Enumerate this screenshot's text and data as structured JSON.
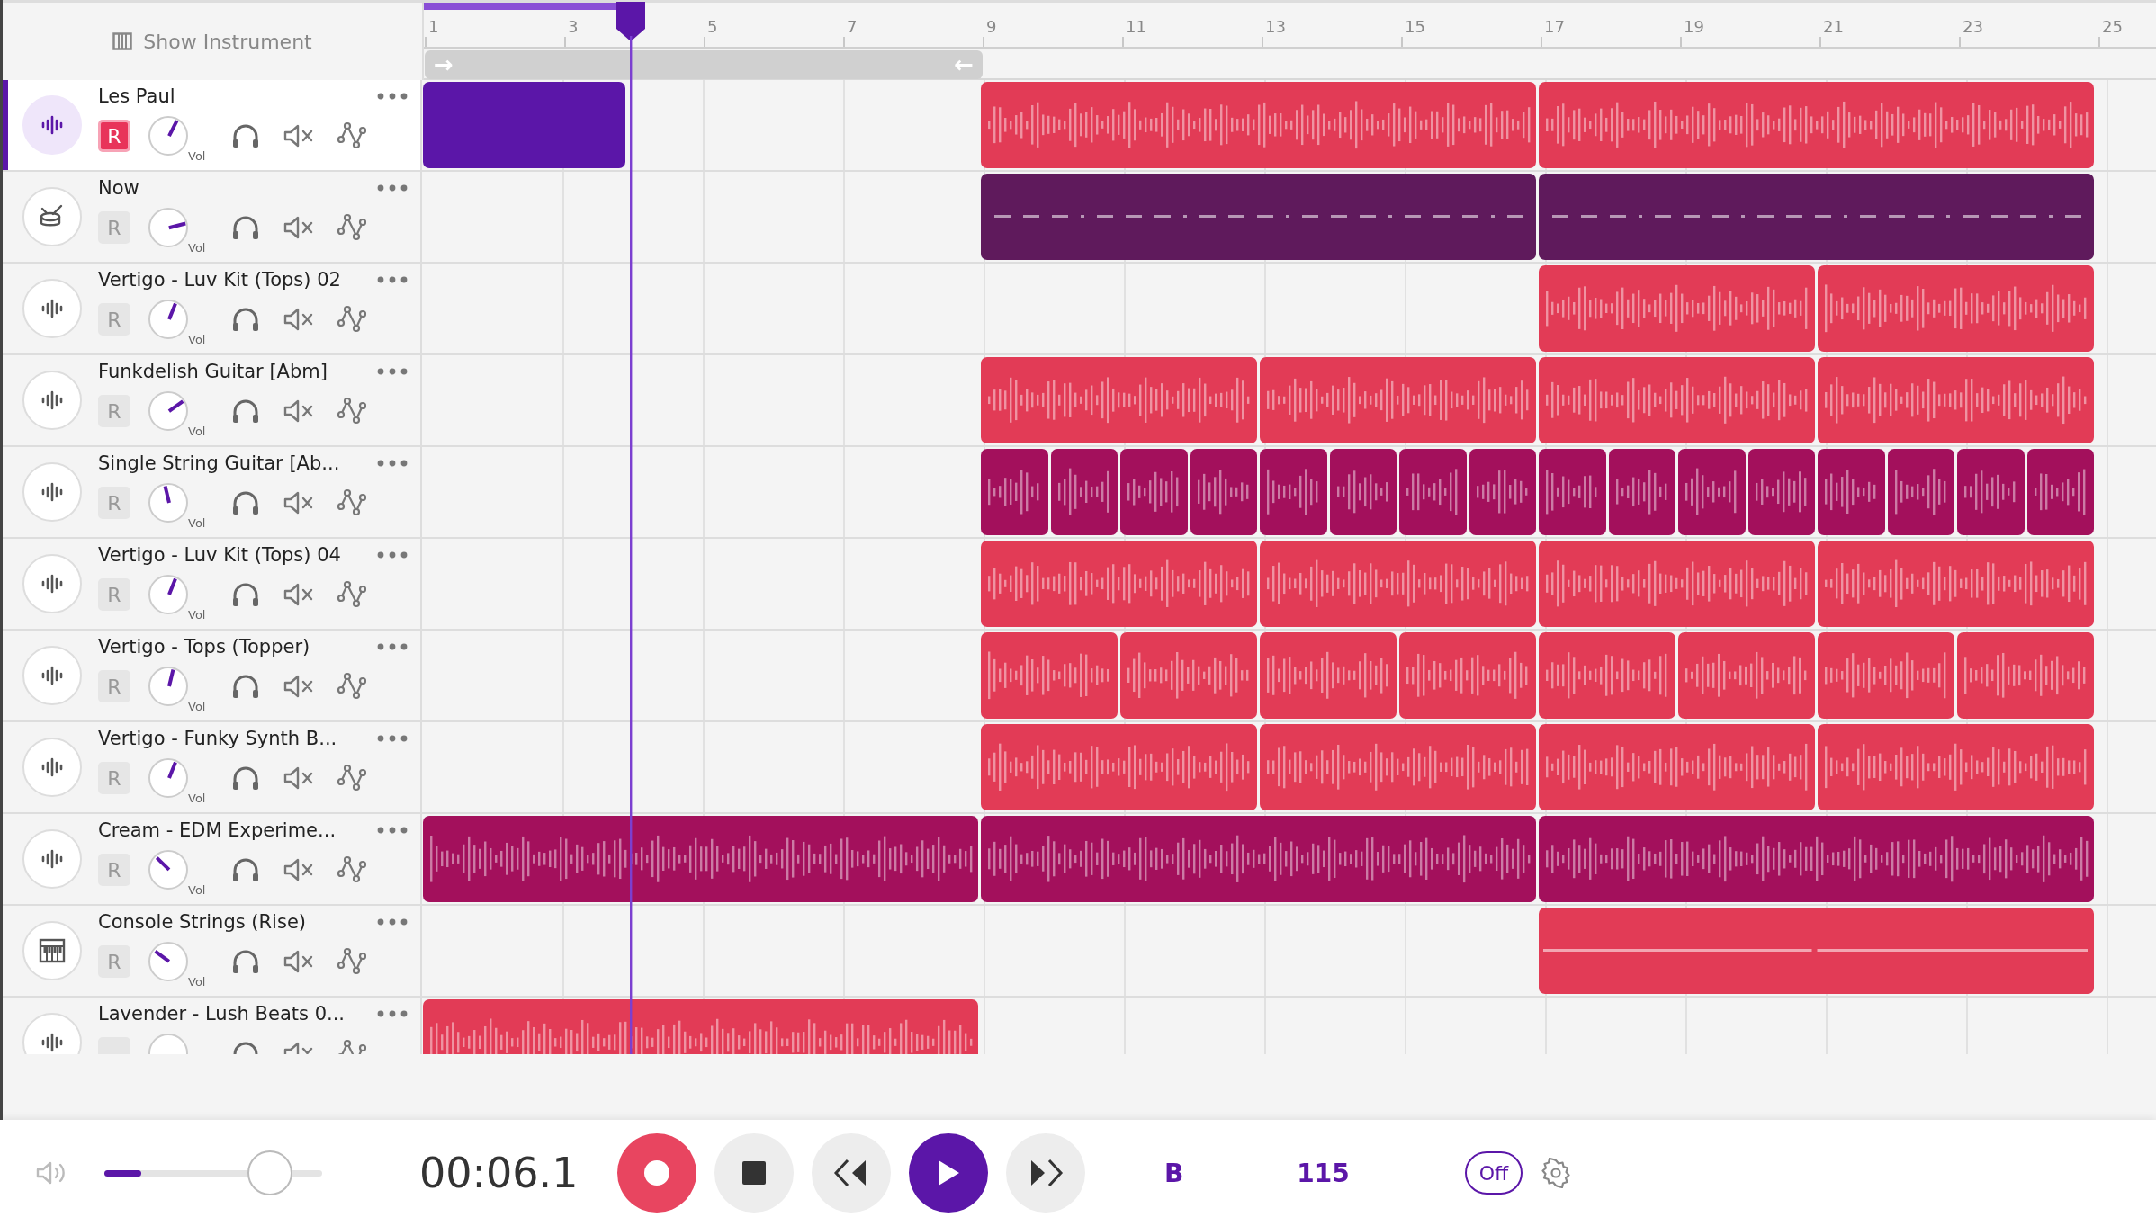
{
  "header": {
    "show_instrument": "Show Instrument"
  },
  "ruler": {
    "labels": [
      "1",
      "3",
      "5",
      "7",
      "9",
      "11",
      "13",
      "15",
      "17",
      "19",
      "21",
      "23",
      "25"
    ],
    "cycle": {
      "start_arrow": "→",
      "end_arrow": "←"
    }
  },
  "playhead": {
    "level": 0.119
  },
  "tracks": [
    {
      "name": "Les Paul",
      "kind": "audio",
      "selected": true,
      "armed": true,
      "level": 0.6,
      "record_label": "R",
      "knob_label": "Vol",
      "clips": [
        {
          "kind": "recording",
          "color": "#5b16a8"
        },
        {
          "kind": "audio",
          "color": "#e23b56"
        },
        {
          "kind": "audio",
          "color": "#e23b56"
        }
      ]
    },
    {
      "name": "Now",
      "kind": "drums",
      "selected": false,
      "armed": false,
      "level": 0.78,
      "record_label": "R",
      "knob_label": "Vol",
      "clips": [
        {
          "kind": "pattern",
          "color": "#5f1a5c"
        },
        {
          "kind": "pattern",
          "color": "#5f1a5c"
        }
      ]
    },
    {
      "name": "Vertigo - Luv Kit (Tops) 02",
      "kind": "audio",
      "selected": false,
      "armed": false,
      "level": 0.58,
      "record_label": "R",
      "knob_label": "Vol",
      "clips": [
        {
          "kind": "audio",
          "color": "#e23b56"
        },
        {
          "kind": "audio",
          "color": "#e23b56"
        }
      ]
    },
    {
      "name": "Funkdelish Guitar [Abm]",
      "kind": "audio",
      "selected": false,
      "armed": false,
      "level": 0.7,
      "record_label": "R",
      "knob_label": "Vol",
      "clips": [
        {
          "kind": "audio",
          "color": "#e23b56"
        },
        {
          "kind": "audio",
          "color": "#e23b56"
        },
        {
          "kind": "audio",
          "color": "#e23b56"
        },
        {
          "kind": "audio",
          "color": "#e23b56"
        }
      ]
    },
    {
      "name": "Single String Guitar [Ab...",
      "kind": "audio",
      "selected": false,
      "armed": false,
      "level": 0.45,
      "record_label": "R",
      "knob_label": "Vol",
      "clips": [
        {
          "kind": "audio",
          "color": "#a3105c"
        },
        {
          "kind": "audio",
          "color": "#a3105c"
        },
        {
          "kind": "audio",
          "color": "#a3105c"
        },
        {
          "kind": "audio",
          "color": "#a3105c"
        },
        {
          "kind": "audio",
          "color": "#a3105c"
        },
        {
          "kind": "audio",
          "color": "#a3105c"
        },
        {
          "kind": "audio",
          "color": "#a3105c"
        },
        {
          "kind": "audio",
          "color": "#a3105c"
        },
        {
          "kind": "audio",
          "color": "#a3105c"
        },
        {
          "kind": "audio",
          "color": "#a3105c"
        },
        {
          "kind": "audio",
          "color": "#a3105c"
        },
        {
          "kind": "audio",
          "color": "#a3105c"
        },
        {
          "kind": "audio",
          "color": "#a3105c"
        },
        {
          "kind": "audio",
          "color": "#a3105c"
        },
        {
          "kind": "audio",
          "color": "#a3105c"
        },
        {
          "kind": "audio",
          "color": "#a3105c"
        }
      ]
    },
    {
      "name": "Vertigo - Luv Kit (Tops) 04",
      "kind": "audio",
      "selected": false,
      "armed": false,
      "level": 0.58,
      "record_label": "R",
      "knob_label": "Vol",
      "clips": [
        {
          "kind": "audio",
          "color": "#e23b56"
        },
        {
          "kind": "audio",
          "color": "#e23b56"
        },
        {
          "kind": "audio",
          "color": "#e23b56"
        },
        {
          "kind": "audio",
          "color": "#e23b56"
        }
      ]
    },
    {
      "name": "Vertigo - Tops (Topper)",
      "kind": "audio",
      "selected": false,
      "armed": false,
      "level": 0.55,
      "record_label": "R",
      "knob_label": "Vol",
      "clips": [
        {
          "kind": "audio",
          "color": "#e23b56"
        },
        {
          "kind": "audio",
          "color": "#e23b56"
        },
        {
          "kind": "audio",
          "color": "#e23b56"
        },
        {
          "kind": "audio",
          "color": "#e23b56"
        },
        {
          "kind": "audio",
          "color": "#e23b56"
        },
        {
          "kind": "audio",
          "color": "#e23b56"
        },
        {
          "kind": "audio",
          "color": "#e23b56"
        },
        {
          "kind": "audio",
          "color": "#e23b56"
        }
      ]
    },
    {
      "name": "Vertigo - Funky Synth B...",
      "kind": "audio",
      "selected": false,
      "armed": false,
      "level": 0.58,
      "record_label": "R",
      "knob_label": "Vol",
      "clips": [
        {
          "kind": "audio",
          "color": "#e23b56"
        },
        {
          "kind": "audio",
          "color": "#e23b56"
        },
        {
          "kind": "audio",
          "color": "#e23b56"
        },
        {
          "kind": "audio",
          "color": "#e23b56"
        }
      ]
    },
    {
      "name": "Cream - EDM Experime...",
      "kind": "audio",
      "selected": false,
      "armed": false,
      "level": 0.33,
      "record_label": "R",
      "knob_label": "Vol",
      "clips": [
        {
          "kind": "audio",
          "color": "#a3105c"
        },
        {
          "kind": "audio",
          "color": "#a3105c"
        },
        {
          "kind": "audio",
          "color": "#a3105c"
        }
      ]
    },
    {
      "name": "Console Strings (Rise)",
      "kind": "instrument",
      "selected": false,
      "armed": false,
      "level": 0.3,
      "record_label": "R",
      "knob_label": "Vol",
      "clips": [
        {
          "kind": "line",
          "color": "#e23b56"
        }
      ]
    },
    {
      "name": "Lavender - Lush Beats 0...",
      "kind": "audio",
      "selected": false,
      "armed": false,
      "clips": [
        {
          "kind": "audio",
          "color": "#e23b56"
        }
      ]
    }
  ],
  "transport": {
    "volume_slider": {
      "level": 0.76
    },
    "output_meter": {
      "level": 0.17
    },
    "time": "00:06.1",
    "key": "B",
    "tempo": "115",
    "metronome": "Off"
  }
}
